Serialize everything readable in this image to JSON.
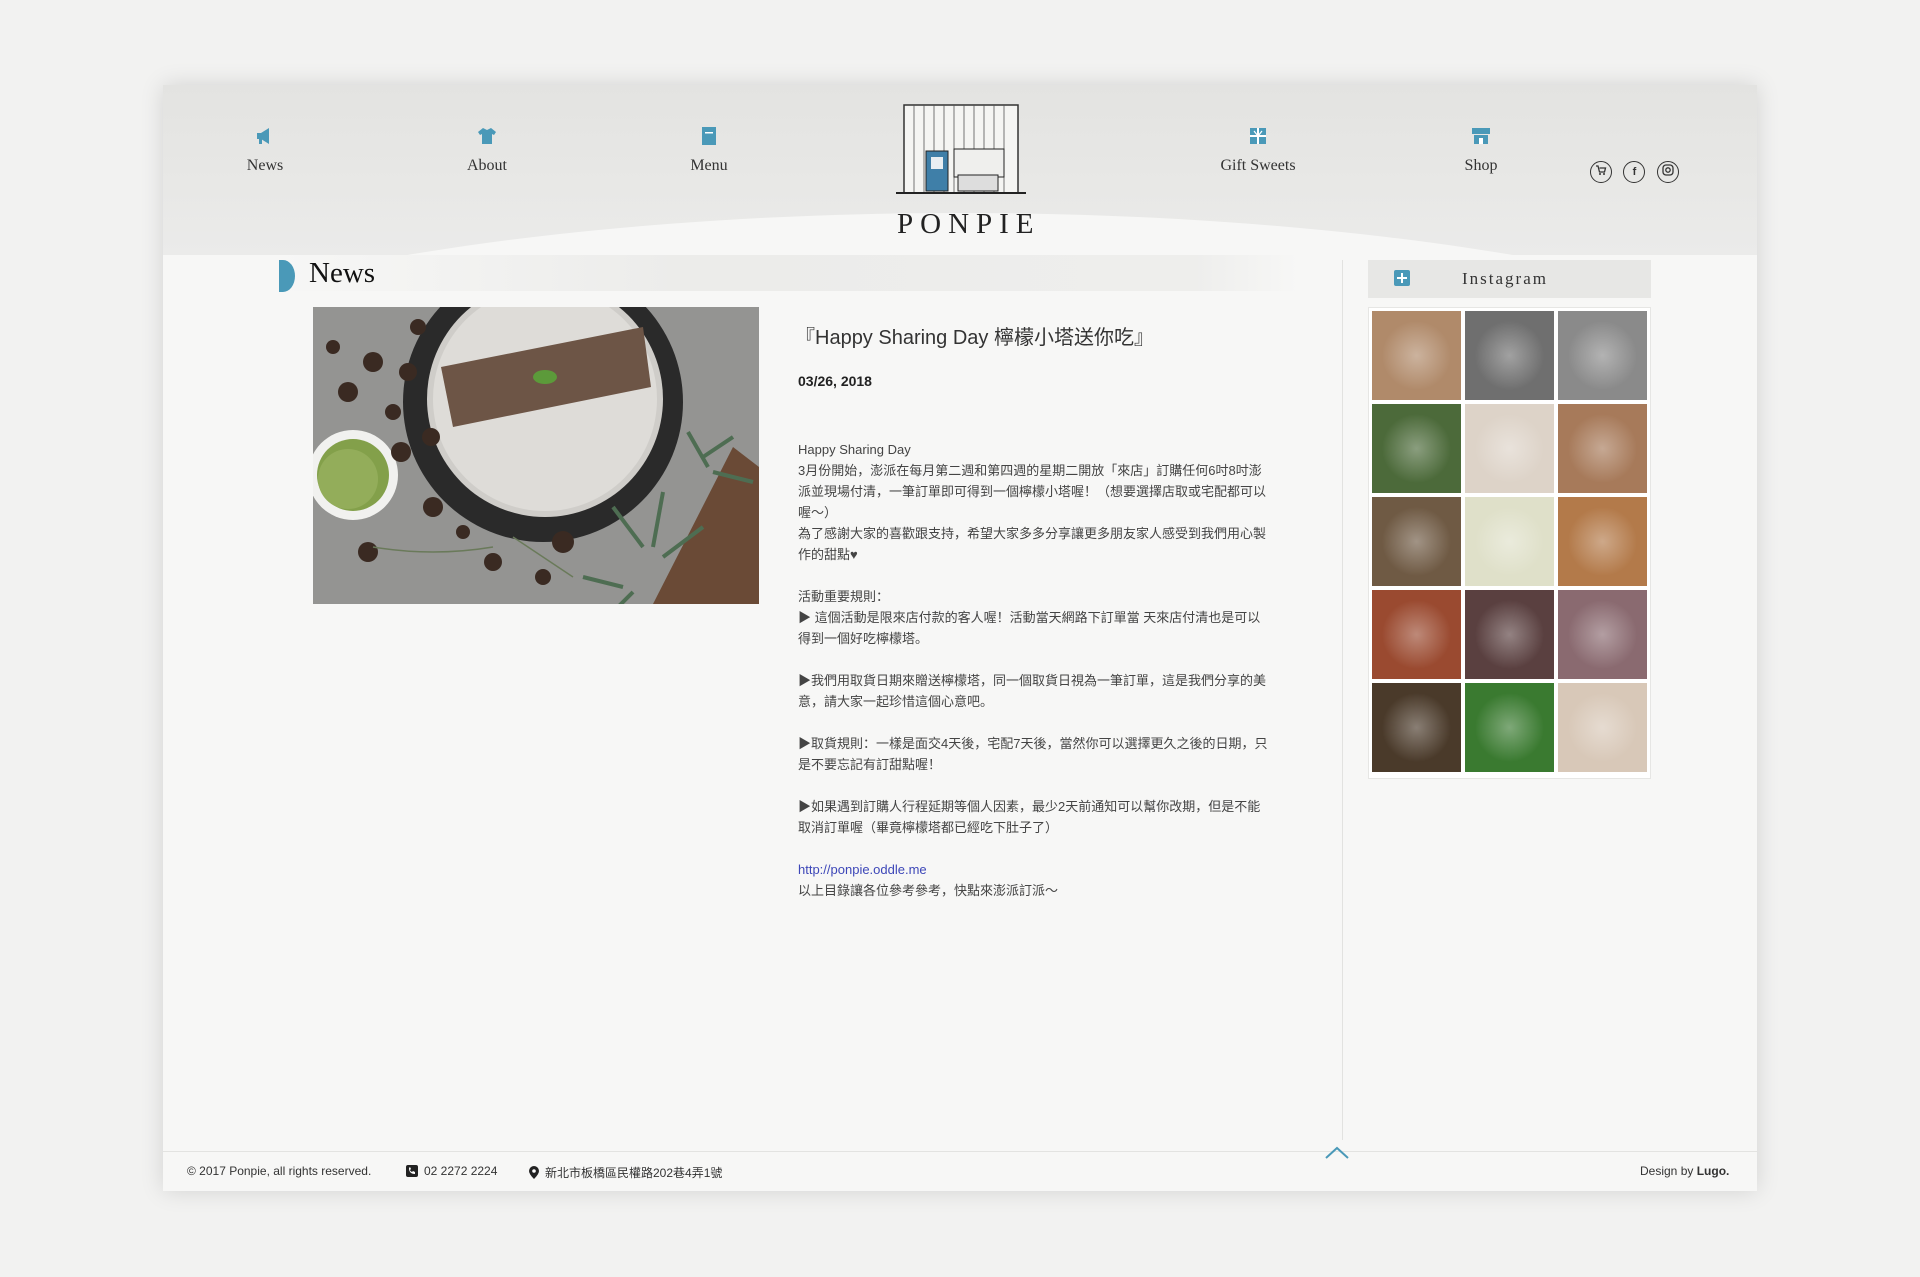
{
  "nav": {
    "items": [
      {
        "label": "News",
        "icon": "megaphone-icon"
      },
      {
        "label": "About",
        "icon": "shirt-icon"
      },
      {
        "label": "Menu",
        "icon": "menu-book-icon"
      },
      {
        "label": "Gift Sweets",
        "icon": "gift-icon"
      },
      {
        "label": "Shop",
        "icon": "shop-icon"
      }
    ],
    "social": [
      "cart-icon",
      "facebook-icon",
      "instagram-icon"
    ]
  },
  "logo": {
    "text": "PONPIE"
  },
  "section": {
    "title": "News"
  },
  "post": {
    "title": "『Happy Sharing Day 檸檬小塔送你吃』",
    "date": "03/26, 2018",
    "body": {
      "p1": "Happy Sharing Day",
      "p2": "3月份開始，澎派在每月第二週和第四週的星期二開放「來店」訂購任何6吋8吋澎派並現場付清，一筆訂單即可得到一個檸檬小塔喔！（想要選擇店取或宅配都可以喔～）",
      "p3": "為了感謝大家的喜歡跟支持，希望大家多多分享讓更多朋友家人感受到我們用心製作的甜點♥",
      "p4": "活動重要規則：",
      "p5": "▶ 這個活動是限來店付款的客人喔！活動當天網路下訂單當 天來店付清也是可以得到一個好吃檸檬塔。",
      "p6": "▶我們用取貨日期來贈送檸檬塔，同一個取貨日視為一筆訂單，這是我們分享的美意，請大家一起珍惜這個心意吧。",
      "p7": "▶取貨規則：一樣是面交4天後，宅配7天後，當然你可以選擇更久之後的日期，只是不要忘記有訂甜點喔！",
      "p8": "▶如果遇到訂購人行程延期等個人因素，最少2天前通知可以幫你改期，但是不能取消訂單喔（畢竟檸檬塔都已經吃下肚子了）",
      "link": "http://ponpie.oddle.me",
      "p9": "以上目錄讓各位參考參考，快點來澎派訂派～"
    }
  },
  "instagram": {
    "title": "Instagram",
    "colors": [
      "#b08a6a",
      "#6f6f6f",
      "#8a8a8a",
      "#4c6a3a",
      "#ddd3c8",
      "#a77a5a",
      "#6f5a44",
      "#dfe0c9",
      "#b37a4a",
      "#9a4a30",
      "#5a4040",
      "#8a6a70",
      "#4a3a2a",
      "#3a7a30",
      "#d8c8b8"
    ]
  },
  "footer": {
    "copyright": "© 2017 Ponpie, all rights reserved.",
    "phone": "02 2272 2224",
    "address": "新北市板橋區民權路202巷4弄1號",
    "design_prefix": "Design by ",
    "designer": "Lugo."
  }
}
